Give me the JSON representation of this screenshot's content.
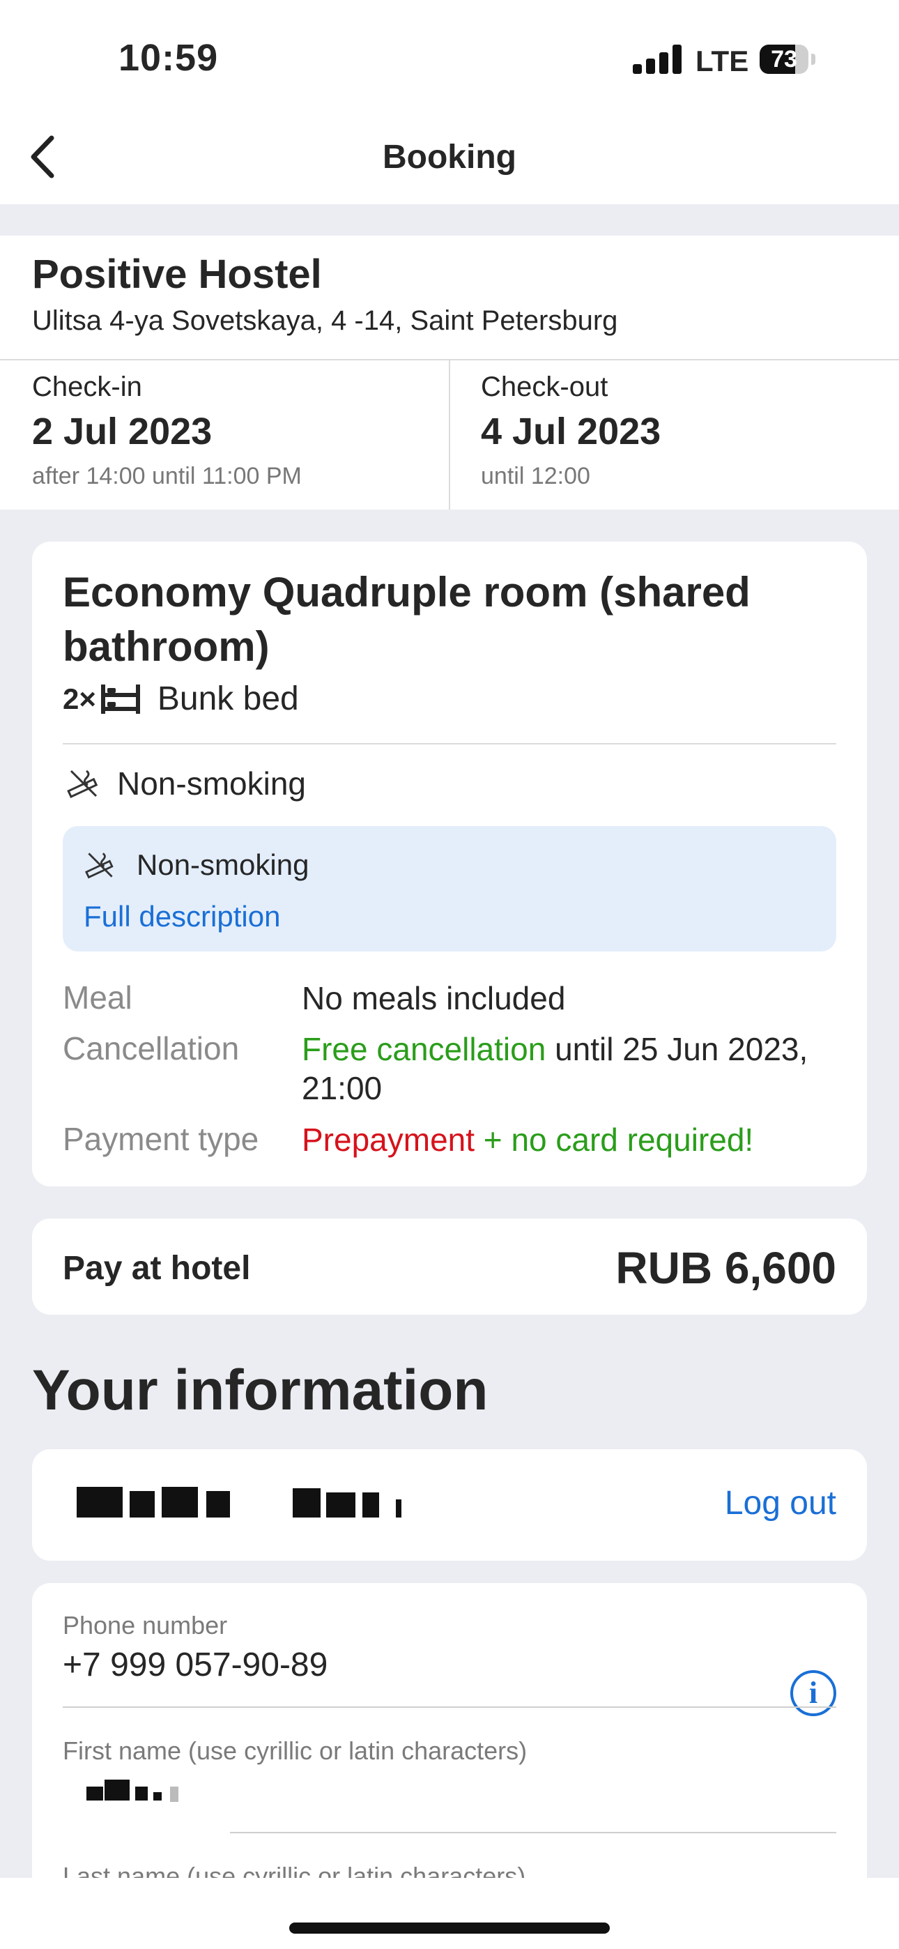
{
  "status_bar": {
    "time": "10:59",
    "network": "LTE",
    "battery": "73",
    "battery_level": 0.73
  },
  "nav": {
    "title": "Booking",
    "back_icon": "chevron-left-icon"
  },
  "hotel": {
    "name": "Positive Hostel",
    "address": "Ulitsa 4-ya Sovetskaya, 4 -14, Saint Petersburg",
    "checkin": {
      "label": "Check-in",
      "date": "2 Jul 2023",
      "note": "after 14:00 until 11:00 PM"
    },
    "checkout": {
      "label": "Check-out",
      "date": "4 Jul 2023",
      "note": "until 12:00"
    }
  },
  "room": {
    "title": "Economy Quadruple room (shared bathroom)",
    "bed_multiplier": "2×",
    "bed_icon": "bunk-bed-icon",
    "bed_label": "Bunk bed",
    "smoking_label": "Non-smoking",
    "smoking_icon": "no-smoking-icon",
    "description": {
      "label": "Non-smoking",
      "link": "Full description"
    },
    "meal": {
      "label": "Meal",
      "value": "No meals included"
    },
    "cancellation": {
      "label": "Cancellation",
      "free": "Free cancellation",
      "rest": " until 25 Jun 2023, 21:00"
    },
    "payment": {
      "label": "Payment type",
      "prepay": "Prepayment",
      "rest": " + no card required!"
    }
  },
  "pay": {
    "label": "Pay at hotel",
    "amount": "RUB 6,600"
  },
  "your_info": {
    "title": "Your information",
    "logout": "Log out",
    "phone": {
      "label": "Phone number",
      "value": "+7 999 057-90-89"
    },
    "first_name": {
      "label": "First name (use cyrillic or latin characters)"
    },
    "last_name": {
      "label": "Last name (use cyrillic or latin characters)"
    }
  },
  "colors": {
    "link": "#1a6fd6",
    "green": "#2a9d1a",
    "red": "#d6121b",
    "background": "#ebedf2"
  }
}
